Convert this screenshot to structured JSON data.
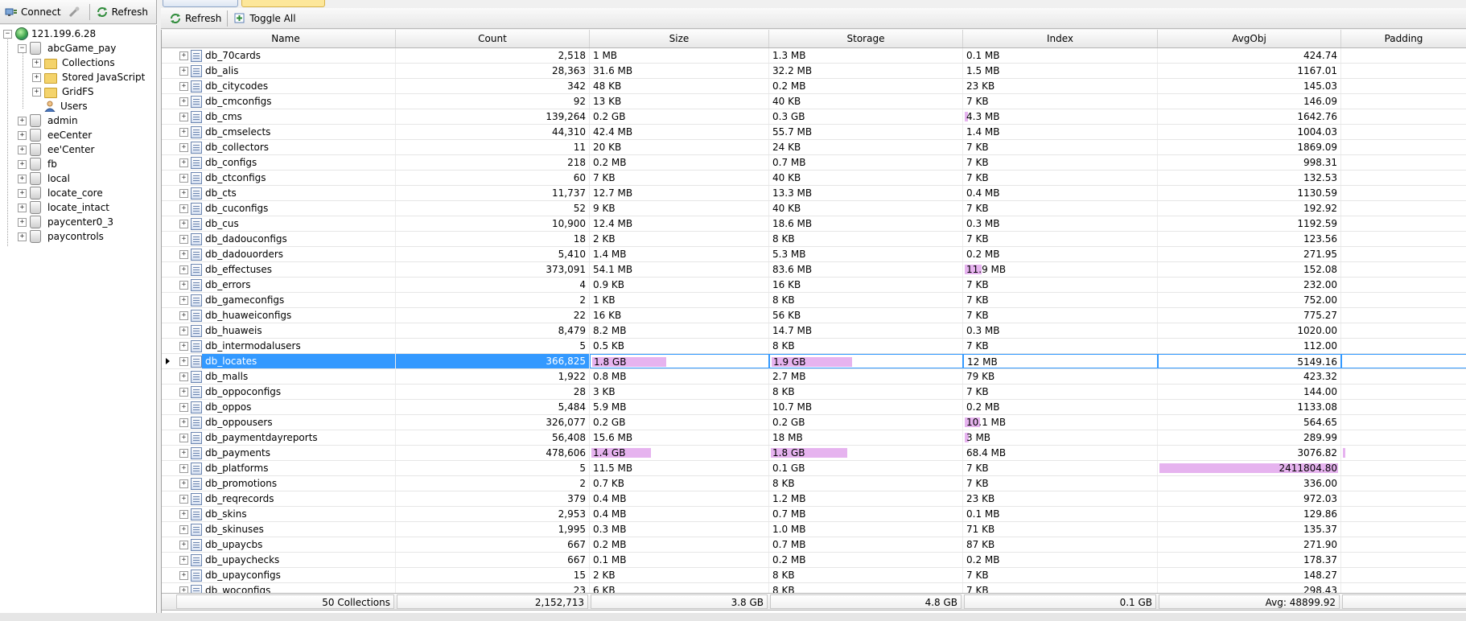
{
  "left_toolbar": {
    "connect": "Connect",
    "refresh": "Refresh"
  },
  "tree": {
    "server": "121.199.6.28",
    "databases": [
      {
        "name": "abcGame_pay",
        "expanded": true,
        "children": [
          "Collections",
          "Stored JavaScript",
          "GridFS",
          "Users"
        ]
      },
      {
        "name": "admin"
      },
      {
        "name": "eeCenter"
      },
      {
        "name": "ee'Center"
      },
      {
        "name": "fb"
      },
      {
        "name": "local"
      },
      {
        "name": "locate_core"
      },
      {
        "name": "locate_intact"
      },
      {
        "name": "paycenter0_3"
      },
      {
        "name": "paycontrols"
      }
    ]
  },
  "grid_toolbar": {
    "refresh": "Refresh",
    "toggle_all": "Toggle All"
  },
  "columns": [
    "Name",
    "Count",
    "Size",
    "Storage",
    "Index",
    "AvgObj",
    "Padding"
  ],
  "rows": [
    {
      "name": "db_70cards",
      "count": "2,518",
      "size": "1 MB",
      "storage": "1.3 MB",
      "index": "0.1 MB",
      "avgobj": "424.74"
    },
    {
      "name": "db_alis",
      "count": "28,363",
      "size": "31.6 MB",
      "storage": "32.2 MB",
      "index": "1.5 MB",
      "avgobj": "1167.01"
    },
    {
      "name": "db_citycodes",
      "count": "342",
      "size": "48 KB",
      "storage": "0.2 MB",
      "index": "23 KB",
      "avgobj": "145.03"
    },
    {
      "name": "db_cmconfigs",
      "count": "92",
      "size": "13 KB",
      "storage": "40 KB",
      "index": "7 KB",
      "avgobj": "146.09"
    },
    {
      "name": "db_cms",
      "count": "139,264",
      "size": "0.2 GB",
      "storage": "0.3 GB",
      "index": "4.3 MB",
      "avgobj": "1642.76",
      "index_frac": 0.015
    },
    {
      "name": "db_cmselects",
      "count": "44,310",
      "size": "42.4 MB",
      "storage": "55.7 MB",
      "index": "1.4 MB",
      "avgobj": "1004.03"
    },
    {
      "name": "db_collectors",
      "count": "11",
      "size": "20 KB",
      "storage": "24 KB",
      "index": "7 KB",
      "avgobj": "1869.09"
    },
    {
      "name": "db_configs",
      "count": "218",
      "size": "0.2 MB",
      "storage": "0.7 MB",
      "index": "7 KB",
      "avgobj": "998.31"
    },
    {
      "name": "db_ctconfigs",
      "count": "60",
      "size": "7 KB",
      "storage": "40 KB",
      "index": "7 KB",
      "avgobj": "132.53"
    },
    {
      "name": "db_cts",
      "count": "11,737",
      "size": "12.7 MB",
      "storage": "13.3 MB",
      "index": "0.4 MB",
      "avgobj": "1130.59"
    },
    {
      "name": "db_cuconfigs",
      "count": "52",
      "size": "9 KB",
      "storage": "40 KB",
      "index": "7 KB",
      "avgobj": "192.92"
    },
    {
      "name": "db_cus",
      "count": "10,900",
      "size": "12.4 MB",
      "storage": "18.6 MB",
      "index": "0.3 MB",
      "avgobj": "1192.59"
    },
    {
      "name": "db_dadouconfigs",
      "count": "18",
      "size": "2 KB",
      "storage": "8 KB",
      "index": "7 KB",
      "avgobj": "123.56"
    },
    {
      "name": "db_dadouorders",
      "count": "5,410",
      "size": "1.4 MB",
      "storage": "5.3 MB",
      "index": "0.2 MB",
      "avgobj": "271.95"
    },
    {
      "name": "db_effectuses",
      "count": "373,091",
      "size": "54.1 MB",
      "storage": "83.6 MB",
      "index": "11.9 MB",
      "avgobj": "152.08",
      "index_frac": 0.09
    },
    {
      "name": "db_errors",
      "count": "4",
      "size": "0.9 KB",
      "storage": "16 KB",
      "index": "7 KB",
      "avgobj": "232.00"
    },
    {
      "name": "db_gameconfigs",
      "count": "2",
      "size": "1 KB",
      "storage": "8 KB",
      "index": "7 KB",
      "avgobj": "752.00"
    },
    {
      "name": "db_huaweiconfigs",
      "count": "22",
      "size": "16 KB",
      "storage": "56 KB",
      "index": "7 KB",
      "avgobj": "775.27"
    },
    {
      "name": "db_huaweis",
      "count": "8,479",
      "size": "8.2 MB",
      "storage": "14.7 MB",
      "index": "0.3 MB",
      "avgobj": "1020.00"
    },
    {
      "name": "db_intermodalusers",
      "count": "5",
      "size": "0.5 KB",
      "storage": "8 KB",
      "index": "7 KB",
      "avgobj": "112.00"
    },
    {
      "name": "db_locates",
      "count": "366,825",
      "size": "1.8 GB",
      "storage": "1.9 GB",
      "index": "12 MB",
      "avgobj": "5149.16",
      "selected": true,
      "size_frac": 0.42,
      "storage_frac": 0.42
    },
    {
      "name": "db_malls",
      "count": "1,922",
      "size": "0.8 MB",
      "storage": "2.7 MB",
      "index": "79 KB",
      "avgobj": "423.32"
    },
    {
      "name": "db_oppoconfigs",
      "count": "28",
      "size": "3 KB",
      "storage": "8 KB",
      "index": "7 KB",
      "avgobj": "144.00"
    },
    {
      "name": "db_oppos",
      "count": "5,484",
      "size": "5.9 MB",
      "storage": "10.7 MB",
      "index": "0.2 MB",
      "avgobj": "1133.08"
    },
    {
      "name": "db_oppousers",
      "count": "326,077",
      "size": "0.2 GB",
      "storage": "0.2 GB",
      "index": "10.1 MB",
      "avgobj": "564.65",
      "index_frac": 0.08
    },
    {
      "name": "db_paymentdayreports",
      "count": "56,408",
      "size": "15.6 MB",
      "storage": "18 MB",
      "index": "3 MB",
      "avgobj": "289.99",
      "index_frac": 0.02
    },
    {
      "name": "db_payments",
      "count": "478,606",
      "size": "1.4 GB",
      "storage": "1.8 GB",
      "index": "68.4 MB",
      "avgobj": "3076.82",
      "size_frac": 0.34,
      "storage_frac": 0.4,
      "padding_frac": 0.02
    },
    {
      "name": "db_platforms",
      "count": "5",
      "size": "11.5 MB",
      "storage": "0.1 GB",
      "index": "7 KB",
      "avgobj": "2411804.80",
      "avgobj_frac": 0.99
    },
    {
      "name": "db_promotions",
      "count": "2",
      "size": "0.7 KB",
      "storage": "8 KB",
      "index": "7 KB",
      "avgobj": "336.00"
    },
    {
      "name": "db_reqrecords",
      "count": "379",
      "size": "0.4 MB",
      "storage": "1.2 MB",
      "index": "23 KB",
      "avgobj": "972.03"
    },
    {
      "name": "db_skins",
      "count": "2,953",
      "size": "0.4 MB",
      "storage": "0.7 MB",
      "index": "0.1 MB",
      "avgobj": "129.86"
    },
    {
      "name": "db_skinuses",
      "count": "1,995",
      "size": "0.3 MB",
      "storage": "1.0 MB",
      "index": "71 KB",
      "avgobj": "135.37"
    },
    {
      "name": "db_upaycbs",
      "count": "667",
      "size": "0.2 MB",
      "storage": "0.7 MB",
      "index": "87 KB",
      "avgobj": "271.90"
    },
    {
      "name": "db_upaychecks",
      "count": "667",
      "size": "0.1 MB",
      "storage": "0.2 MB",
      "index": "0.2 MB",
      "avgobj": "178.37"
    },
    {
      "name": "db_upayconfigs",
      "count": "15",
      "size": "2 KB",
      "storage": "8 KB",
      "index": "7 KB",
      "avgobj": "148.27"
    },
    {
      "name": "db_woconfigs",
      "count": "23",
      "size": "6 KB",
      "storage": "8 KB",
      "index": "7 KB",
      "avgobj": "298.43"
    }
  ],
  "footer": {
    "collections": "50 Collections",
    "count": "2,152,713",
    "size": "3.8 GB",
    "storage": "4.8 GB",
    "index": "0.1 GB",
    "avgobj": "Avg: 48899.92"
  },
  "colors": {
    "bar": "#e6b3ef",
    "selection": "#3399ff",
    "active_tab": "#fde79a"
  }
}
